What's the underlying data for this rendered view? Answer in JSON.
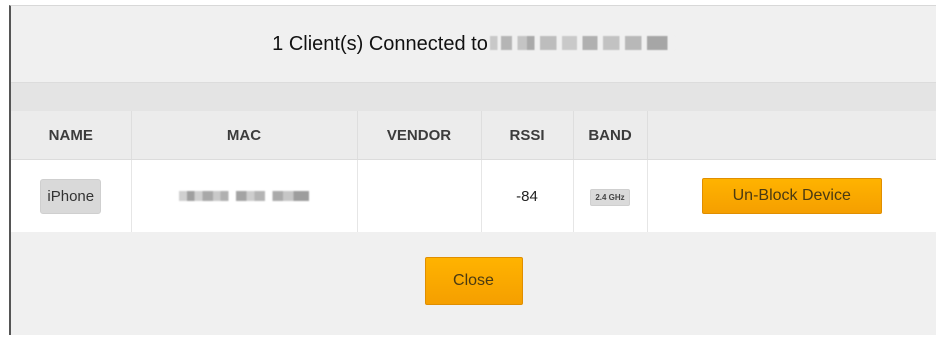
{
  "dialog": {
    "title_prefix": "1 Client(s) Connected to",
    "ssid_redacted": ""
  },
  "table": {
    "columns": [
      "NAME",
      "MAC",
      "VENDOR",
      "RSSI",
      "BAND",
      ""
    ],
    "rows": [
      {
        "name": "iPhone",
        "mac_redacted": "",
        "vendor": "",
        "rssi": "-84",
        "band": "2.4 GHz",
        "action_label": "Un-Block Device"
      }
    ]
  },
  "footer": {
    "close_label": "Close"
  },
  "colors": {
    "accent": "#ffb300",
    "accent_border": "#e08e00"
  }
}
